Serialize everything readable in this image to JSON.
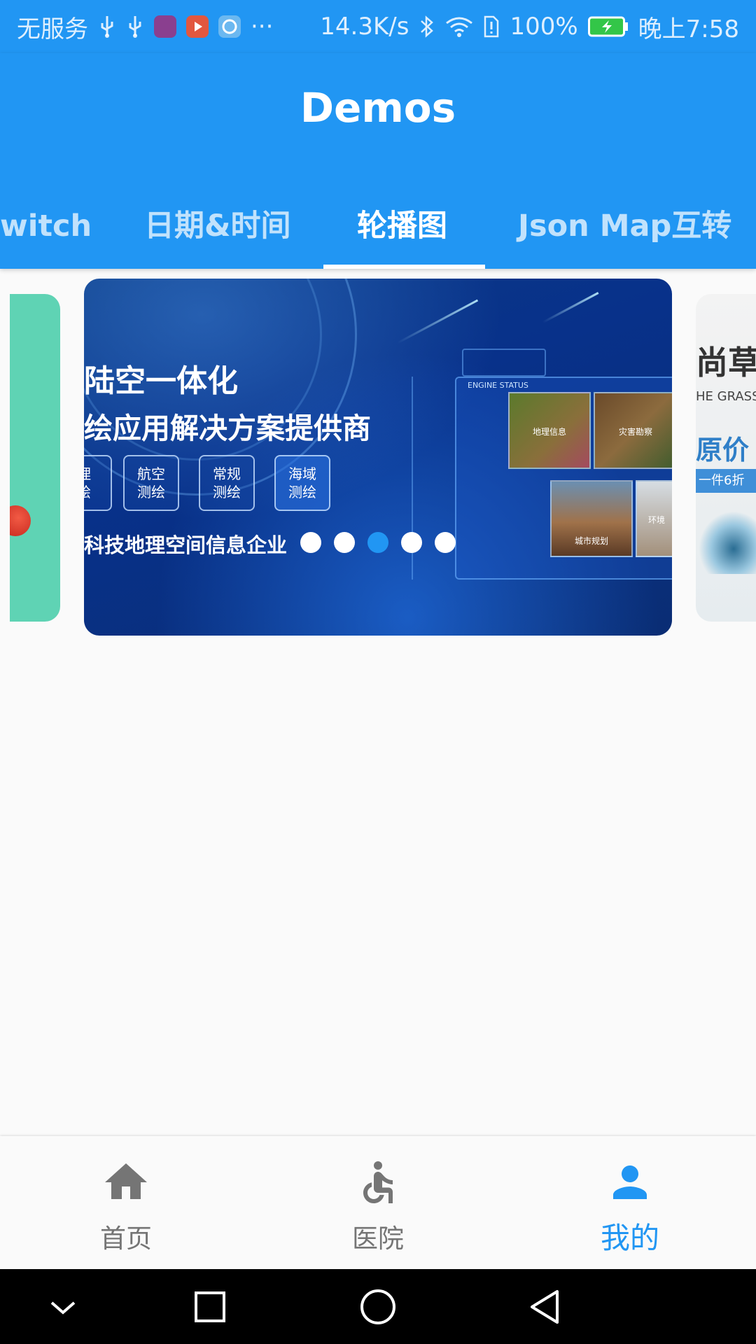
{
  "status_bar": {
    "carrier": "无服务",
    "more": "···",
    "speed": "14.3K/s",
    "battery": "100%",
    "time": "晚上7:58"
  },
  "app_bar": {
    "title": "Demos"
  },
  "tabs": [
    {
      "label": "witch"
    },
    {
      "label": "日期&时间"
    },
    {
      "label": "轮播图"
    },
    {
      "label": "Json Map互转"
    }
  ],
  "active_tab_index": 2,
  "carousel": {
    "main_slide": {
      "heading_line1": "陆空一体化",
      "heading_line2": "绘应用解决方案提供商",
      "badges": [
        "理\n绘",
        "航空\n测绘",
        "常规\n测绘",
        "海域\n测绘"
      ],
      "footer": "科技地理空间信息企业",
      "dashboard_label": "ENGINE STATUS",
      "tiles": [
        "地理信息",
        "灾害勘察",
        "城市规划",
        "环境"
      ]
    },
    "next_slide": {
      "line1": "尚草",
      "line2": "HE GRASS",
      "line3": "原价",
      "line4": "一件6折"
    },
    "dot_count": 5,
    "active_dot": 2
  },
  "bottom_nav": [
    {
      "label": "首页",
      "icon": "home-icon"
    },
    {
      "label": "医院",
      "icon": "accessible-icon"
    },
    {
      "label": "我的",
      "icon": "person-icon"
    }
  ],
  "active_nav_index": 2,
  "colors": {
    "primary": "#2196f3",
    "inactive": "#757575"
  }
}
